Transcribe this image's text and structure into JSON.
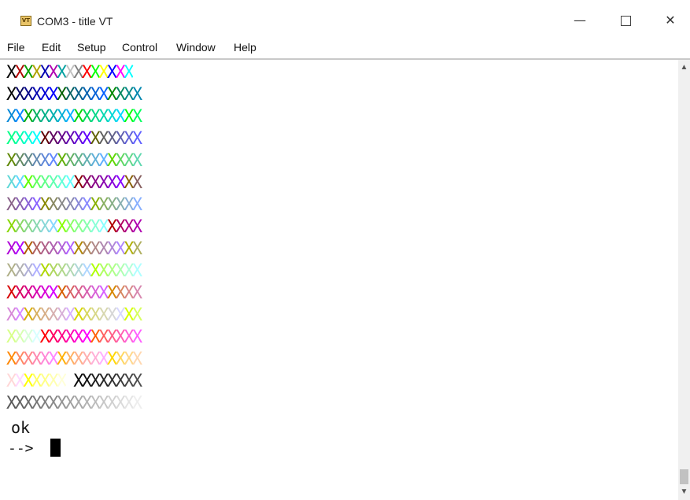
{
  "window": {
    "title": "COM3 - title VT",
    "icon_text": "VT",
    "icon": "vt-terminal-icon",
    "minimize_glyph": "—",
    "close_glyph": "✕"
  },
  "menu": [
    "File",
    "Edit",
    "Setup",
    "Control",
    "Window",
    "Help"
  ],
  "terminal": {
    "rows": [
      {
        "text": "XXXXXXXXXXXXXXXX",
        "colors": [
          "#000000",
          "#b00000",
          "#00a000",
          "#b0a000",
          "#0000b0",
          "#b000b0",
          "#00a0a0",
          "#c0c0c0",
          "#808080",
          "#ff0000",
          "#00ff00",
          "#ffff00",
          "#0000ff",
          "#ff00ff",
          "#00ffff",
          "#ffffff"
        ]
      },
      {
        "text": "XXXXXXXXXXXXXXXX",
        "colors": [
          "#000000",
          "#00005f",
          "#000087",
          "#0000af",
          "#0000d7",
          "#0000ff",
          "#005f00",
          "#005f5f",
          "#005f87",
          "#005faf",
          "#005fd7",
          "#005fff",
          "#008700",
          "#00875f",
          "#008787",
          "#0087af"
        ]
      },
      {
        "text": "XXXXXXXXXXXXXXXX",
        "colors": [
          "#0087d7",
          "#0087ff",
          "#00af00",
          "#00af5f",
          "#00af87",
          "#00afaf",
          "#00afd7",
          "#00afff",
          "#00d700",
          "#00d75f",
          "#00d787",
          "#00d7af",
          "#00d7d7",
          "#00d7ff",
          "#00ff00",
          "#00ff5f"
        ]
      },
      {
        "text": "XXXXXXXXXXXXXXXX",
        "colors": [
          "#00ff87",
          "#00ffaf",
          "#00ffd7",
          "#00ffff",
          "#5f0000",
          "#5f005f",
          "#5f0087",
          "#5f00af",
          "#5f00d7",
          "#5f00ff",
          "#5f5f00",
          "#5f5f5f",
          "#5f5f87",
          "#5f5faf",
          "#5f5fd7",
          "#5f5fff"
        ]
      },
      {
        "text": "XXXXXXXXXXXXXXXX",
        "colors": [
          "#5f8700",
          "#5f875f",
          "#5f8787",
          "#5f87af",
          "#5f87d7",
          "#5f87ff",
          "#5faf00",
          "#5faf5f",
          "#5faf87",
          "#5fafaf",
          "#5fafd7",
          "#5fafff",
          "#5fd700",
          "#5fd75f",
          "#5fd787",
          "#5fd7af"
        ]
      },
      {
        "text": "XXXXXXXXXXXXXXXX",
        "colors": [
          "#5fd7d7",
          "#5fd7ff",
          "#5fff00",
          "#5fff5f",
          "#5fff87",
          "#5fffaf",
          "#5fffd7",
          "#5fffff",
          "#870000",
          "#87005f",
          "#870087",
          "#8700af",
          "#8700d7",
          "#8700ff",
          "#875f00",
          "#875f5f"
        ]
      },
      {
        "text": "XXXXXXXXXXXXXXXX",
        "colors": [
          "#875f87",
          "#875faf",
          "#875fd7",
          "#875fff",
          "#878700",
          "#87875f",
          "#878787",
          "#8787af",
          "#8787d7",
          "#8787ff",
          "#87af00",
          "#87af5f",
          "#87af87",
          "#87afaf",
          "#87afd7",
          "#87afff"
        ]
      },
      {
        "text": "XXXXXXXXXXXXXXXX",
        "colors": [
          "#87d700",
          "#87d75f",
          "#87d787",
          "#87d7af",
          "#87d7d7",
          "#87d7ff",
          "#87ff00",
          "#87ff5f",
          "#87ff87",
          "#87ffaf",
          "#87ffd7",
          "#87ffff",
          "#af0000",
          "#af005f",
          "#af0087",
          "#af00af"
        ]
      },
      {
        "text": "XXXXXXXXXXXXXXXX",
        "colors": [
          "#af00d7",
          "#af00ff",
          "#af5f00",
          "#af5f5f",
          "#af5f87",
          "#af5faf",
          "#af5fd7",
          "#af5fff",
          "#af8700",
          "#af875f",
          "#af8787",
          "#af87af",
          "#af87d7",
          "#af87ff",
          "#afaf00",
          "#afaf5f"
        ]
      },
      {
        "text": "XXXXXXXXXXXXXXXX",
        "colors": [
          "#afaf87",
          "#afafaf",
          "#afafd7",
          "#afafff",
          "#afd700",
          "#afd75f",
          "#afd787",
          "#afd7af",
          "#afd7d7",
          "#afd7ff",
          "#afff00",
          "#afff5f",
          "#afff87",
          "#afffaf",
          "#afffd7",
          "#afffff"
        ]
      },
      {
        "text": "XXXXXXXXXXXXXXXX",
        "colors": [
          "#d70000",
          "#d7005f",
          "#d70087",
          "#d700af",
          "#d700d7",
          "#d700ff",
          "#d75f00",
          "#d75f5f",
          "#d75f87",
          "#d75faf",
          "#d75fd7",
          "#d75fff",
          "#d78700",
          "#d7875f",
          "#d78787",
          "#d787af"
        ]
      },
      {
        "text": "XXXXXXXXXXXXXXXX",
        "colors": [
          "#d787d7",
          "#d787ff",
          "#d7af00",
          "#d7af5f",
          "#d7af87",
          "#d7afaf",
          "#d7afd7",
          "#d7afff",
          "#d7d700",
          "#d7d75f",
          "#d7d787",
          "#d7d7af",
          "#d7d7d7",
          "#d7d7ff",
          "#d7ff00",
          "#d7ff5f"
        ]
      },
      {
        "text": "XXXXXXXXXXXXXXXX",
        "colors": [
          "#d7ff87",
          "#d7ffaf",
          "#d7ffd7",
          "#d7ffff",
          "#ff0000",
          "#ff005f",
          "#ff0087",
          "#ff00af",
          "#ff00d7",
          "#ff00ff",
          "#ff5f00",
          "#ff5f5f",
          "#ff5f87",
          "#ff5faf",
          "#ff5fd7",
          "#ff5fff"
        ]
      },
      {
        "text": "XXXXXXXXXXXXXXXX",
        "colors": [
          "#ff8700",
          "#ff875f",
          "#ff8787",
          "#ff87af",
          "#ff87d7",
          "#ff87ff",
          "#ffaf00",
          "#ffaf5f",
          "#ffaf87",
          "#ffafaf",
          "#ffafd7",
          "#ffafff",
          "#ffd700",
          "#ffd75f",
          "#ffd787",
          "#ffd7af"
        ]
      },
      {
        "text": "XXXXXXXXXXXXXXXX",
        "colors": [
          "#ffd7d7",
          "#ffd7ff",
          "#ffff00",
          "#ffff5f",
          "#ffff87",
          "#ffffaf",
          "#ffffd7",
          "#ffffff",
          "#080808",
          "#121212",
          "#1c1c1c",
          "#262626",
          "#303030",
          "#3a3a3a",
          "#444444",
          "#4e4e4e"
        ]
      },
      {
        "text": "XXXXXXXXXXXXXXXX",
        "colors": [
          "#585858",
          "#626262",
          "#6c6c6c",
          "#767676",
          "#808080",
          "#8a8a8a",
          "#949494",
          "#9e9e9e",
          "#a8a8a8",
          "#b2b2b2",
          "#bcbcbc",
          "#c6c6c6",
          "#d0d0d0",
          "#dadada",
          "#e4e4e4",
          "#eeeeee"
        ]
      }
    ],
    "ok_text": "ok",
    "prompt": "-->"
  }
}
